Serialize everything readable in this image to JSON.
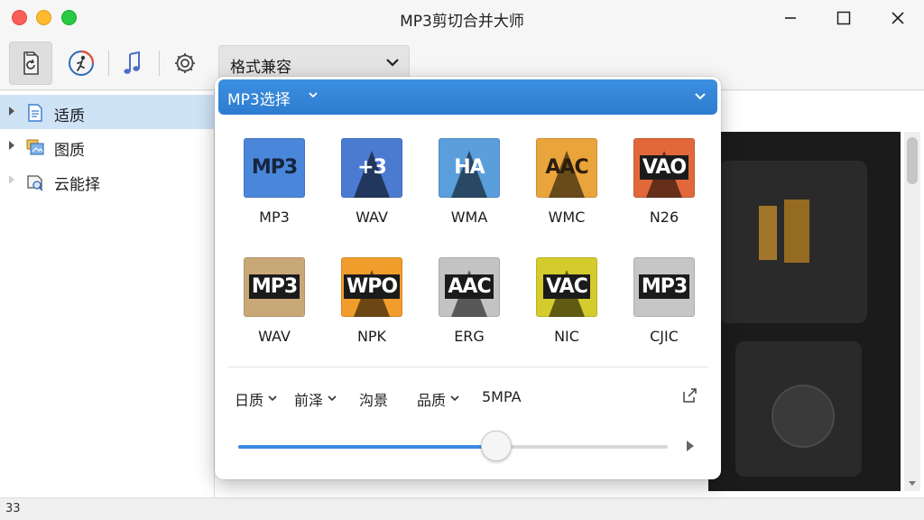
{
  "window": {
    "title": "MP3剪切合并大师"
  },
  "toolbar": {
    "buttons": [
      {
        "name": "refresh-file",
        "icon": "document-refresh-icon",
        "active": true
      },
      {
        "name": "run",
        "icon": "running-figure-icon",
        "active": false
      },
      {
        "name": "music",
        "icon": "music-note-icon",
        "active": false
      },
      {
        "name": "settings",
        "icon": "gear-icon",
        "active": false
      }
    ],
    "format_dropdown": {
      "label": "格式兼容"
    }
  },
  "sidebar": {
    "items": [
      {
        "label": "适质",
        "icon": "document-icon",
        "selected": true
      },
      {
        "label": "图质",
        "icon": "picture-stack-icon",
        "selected": false
      },
      {
        "label": "云能择",
        "icon": "cloud-edit-icon",
        "selected": false
      }
    ]
  },
  "popup": {
    "header_label": "MP3选择",
    "formats": [
      {
        "code": "MP3",
        "name": "MP3",
        "bg": "#4a86d9",
        "fg": "#16253d",
        "peak": false,
        "boxed": false
      },
      {
        "code": "+3",
        "name": "WAV",
        "bg": "#4b7bd1",
        "fg": "#ffffff",
        "peak": true,
        "boxed": false
      },
      {
        "code": "HA",
        "name": "WMA",
        "bg": "#5a9fdb",
        "fg": "#ffffff",
        "peak": true,
        "boxed": false
      },
      {
        "code": "AAC",
        "name": "WMC",
        "bg": "#e9a43c",
        "fg": "#2a1d0c",
        "peak": true,
        "boxed": false
      },
      {
        "code": "VAO",
        "name": "N26",
        "bg": "#e1683a",
        "fg": "#ffffff",
        "peak": true,
        "boxed": true
      },
      {
        "code": "MP3",
        "name": "WAV",
        "bg": "#c9a878",
        "fg": "#ffffff",
        "peak": false,
        "boxed": true
      },
      {
        "code": "WPO",
        "name": "NPK",
        "bg": "#f19d2b",
        "fg": "#ffffff",
        "peak": true,
        "boxed": true
      },
      {
        "code": "AAC",
        "name": "ERG",
        "bg": "#c3c3c3",
        "fg": "#ffffff",
        "peak": true,
        "boxed": true
      },
      {
        "code": "VAC",
        "name": "NIC",
        "bg": "#d4cb2c",
        "fg": "#ffffff",
        "peak": true,
        "boxed": true
      },
      {
        "code": "MP3",
        "name": "CJIC",
        "bg": "#c6c6c6",
        "fg": "#ffffff",
        "peak": false,
        "boxed": true
      }
    ],
    "options": [
      {
        "label": "日质",
        "dropdown": true
      },
      {
        "label": "前泽",
        "dropdown": true
      },
      {
        "label": "沟景",
        "dropdown": false
      },
      {
        "label": "品质",
        "dropdown": true
      },
      {
        "label": "5MPA",
        "dropdown": false
      }
    ],
    "slider": {
      "value": 0.6
    }
  },
  "statusbar": {
    "text": "33"
  },
  "colors": {
    "accent": "#2d7cd0",
    "selection": "#cfe3f7",
    "preview_bg": "#1b1b1b"
  }
}
